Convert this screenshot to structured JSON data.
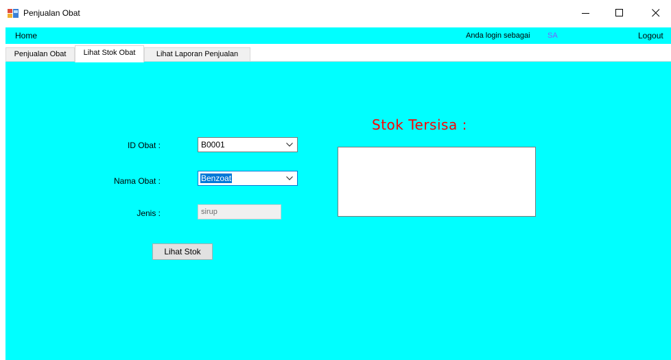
{
  "window": {
    "title": "Penjualan Obat"
  },
  "menu": {
    "home": "Home",
    "login_label": "Anda login sebagai",
    "login_user": "SA",
    "logout": "Logout"
  },
  "tabs": [
    {
      "label": "Penjualan Obat",
      "active": false
    },
    {
      "label": "Lihat Stok Obat",
      "active": true
    },
    {
      "label": "Lihat Laporan Penjualan",
      "active": false
    }
  ],
  "form": {
    "id_obat_label": "ID Obat :",
    "id_obat_value": "B0001",
    "nama_obat_label": "Nama Obat :",
    "nama_obat_value": "Benzoat",
    "jenis_label": "Jenis :",
    "jenis_value": "sirup",
    "lihat_stok_button": "Lihat Stok"
  },
  "stok": {
    "title": "Stok Tersisa :",
    "value": ""
  },
  "colors": {
    "background": "#00ffff",
    "title_red": "#ff0000",
    "user_purple": "#7b5cff",
    "selection_blue": "#0078d7"
  }
}
